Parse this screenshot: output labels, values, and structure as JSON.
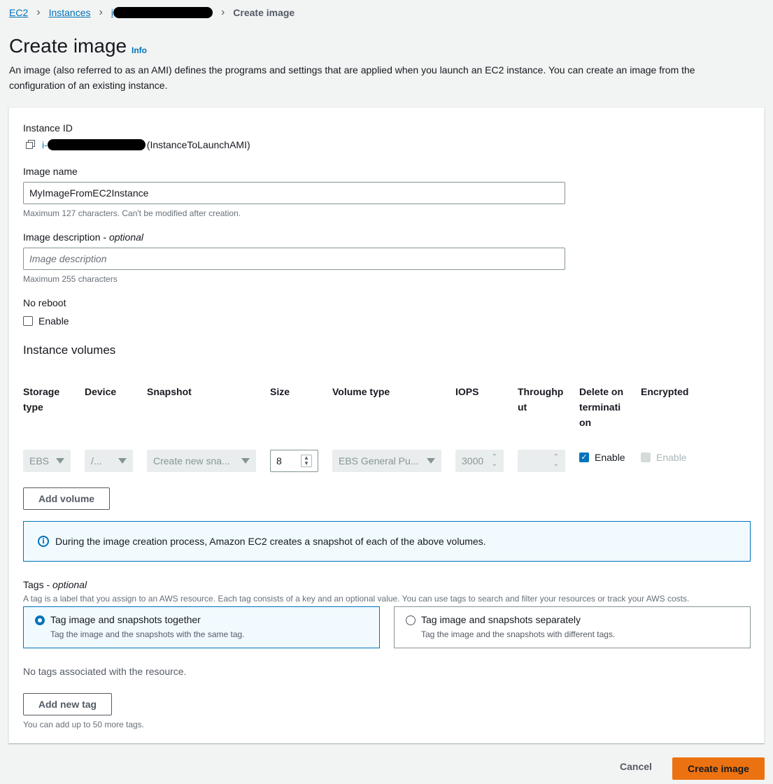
{
  "breadcrumb": {
    "home": "EC2",
    "instances": "Instances",
    "instance_prefix": "i",
    "current": "Create image"
  },
  "page": {
    "title": "Create image",
    "info": "Info",
    "description": "An image (also referred to as an AMI) defines the programs and settings that are applied when you launch an EC2 instance. You can create an image from the configuration of an existing instance."
  },
  "instance": {
    "label": "Instance ID",
    "id_prefix": "i-",
    "name": "(InstanceToLaunchAMI)"
  },
  "image_name": {
    "label": "Image name",
    "value": "MyImageFromEC2Instance",
    "hint": "Maximum 127 characters. Can't be modified after creation."
  },
  "image_description": {
    "label": "Image description",
    "optional": "optional",
    "separator": " - ",
    "placeholder": "Image description",
    "hint": "Maximum 255 characters"
  },
  "no_reboot": {
    "label": "No reboot",
    "option": "Enable",
    "checked": false
  },
  "volumes": {
    "heading": "Instance volumes",
    "columns": {
      "storage_type": [
        "Storage",
        "type"
      ],
      "device": "Device",
      "snapshot": "Snapshot",
      "size": "Size",
      "volume_type": "Volume type",
      "iops": "IOPS",
      "throughput": [
        "Throughp",
        "ut"
      ],
      "delete_on_termination": [
        "Delete on",
        "terminati",
        "on"
      ],
      "encrypted": "Encrypted"
    },
    "row": {
      "storage_type": "EBS",
      "device": "/...",
      "snapshot": "Create new sna...",
      "size": "8",
      "volume_type": "EBS General Pu...",
      "iops": "3000",
      "throughput": "",
      "delete_on_termination": "Enable",
      "encrypted": "Enable"
    },
    "add_button": "Add volume"
  },
  "alert": {
    "icon": "info-icon",
    "text": "During the image creation process, Amazon EC2 creates a snapshot of each of the above volumes."
  },
  "tags": {
    "label": "Tags",
    "optional": "optional",
    "separator": " - ",
    "description": "A tag is a label that you assign to an AWS resource. Each tag consists of a key and an optional value. You can use tags to search and filter your resources or track your AWS costs.",
    "options": [
      {
        "title": "Tag image and snapshots together",
        "subtitle": "Tag the image and the snapshots with the same tag.",
        "selected": true
      },
      {
        "title": "Tag image and snapshots separately",
        "subtitle": "Tag the image and the snapshots with different tags.",
        "selected": false
      }
    ],
    "empty": "No tags associated with the resource.",
    "add_button": "Add new tag",
    "limit_hint": "You can add up to 50 more tags."
  },
  "footer": {
    "cancel": "Cancel",
    "create": "Create image"
  },
  "colors": {
    "primary": "#ec7211",
    "link": "#0073bb",
    "background": "#f2f3f3"
  }
}
